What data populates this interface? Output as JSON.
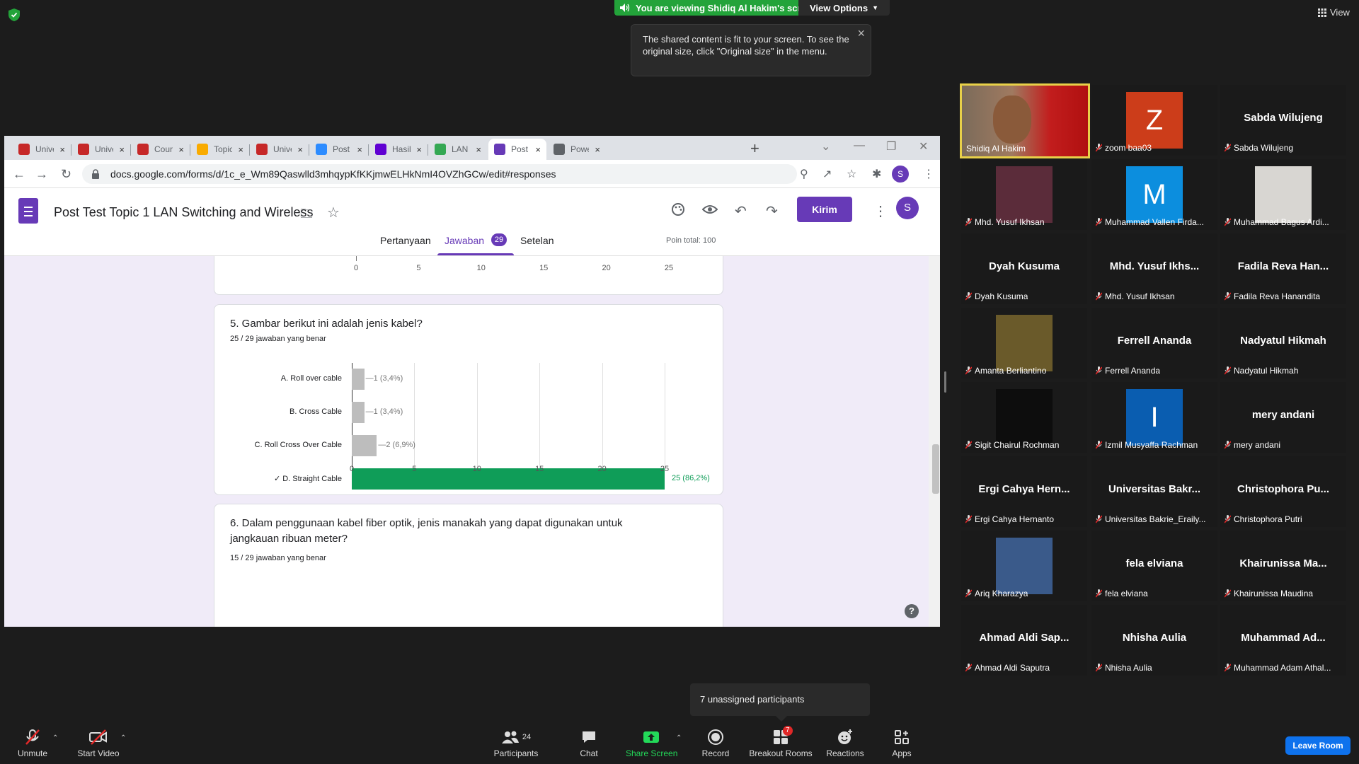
{
  "zoom": {
    "viewing_banner": "You are viewing Shidiq Al Hakim's screen",
    "view_options": "View Options",
    "tooltip": "The shared content is fit to your screen. To see the original size, click \"Original size\" in the menu.",
    "top_view": "View",
    "unassigned": "7 unassigned participants",
    "toolbar": {
      "unmute": "Unmute",
      "start_video": "Start Video",
      "participants": "Participants",
      "participants_count": "24",
      "chat": "Chat",
      "share_screen": "Share Screen",
      "record": "Record",
      "breakout_rooms": "Breakout Rooms",
      "breakout_badge": "7",
      "reactions": "Reactions",
      "apps": "Apps",
      "leave": "Leave Room"
    },
    "participants": [
      {
        "name": "Shidiq Al Hakim",
        "display": "",
        "video": true
      },
      {
        "name": "zoom baa03",
        "display": "Z",
        "avatar_color": "#cc3d1a"
      },
      {
        "name": "Sabda Wilujeng",
        "display": "Sabda Wilujeng"
      },
      {
        "name": "Mhd. Yusuf Ikhsan",
        "display": "",
        "photo": true
      },
      {
        "name": "Muhammad Vallen Firda...",
        "display": "M",
        "avatar_color": "#0c8ede"
      },
      {
        "name": "Muhammad Bagus Ardi...",
        "display": "",
        "photo": true
      },
      {
        "name": "Dyah Kusuma",
        "display": "Dyah Kusuma"
      },
      {
        "name": "Mhd. Yusuf Ikhsan",
        "display": "Mhd. Yusuf Ikhs..."
      },
      {
        "name": "Fadila Reva Hanandita",
        "display": "Fadila Reva Han..."
      },
      {
        "name": "Amanta Berliantino",
        "display": "",
        "photo": true
      },
      {
        "name": "Ferrell Ananda",
        "display": "Ferrell Ananda"
      },
      {
        "name": "Nadyatul Hikmah",
        "display": "Nadyatul Hikmah"
      },
      {
        "name": "Sigit Chairul Rochman",
        "display": "",
        "photo": true
      },
      {
        "name": "Izmil Musyaffa Rachman",
        "display": "I",
        "avatar_color": "#0a5db0"
      },
      {
        "name": "mery andani",
        "display": "mery andani"
      },
      {
        "name": "Ergi Cahya Hernanto",
        "display": "Ergi Cahya Hern..."
      },
      {
        "name": "Universitas Bakrie_Eraily...",
        "display": "Universitas Bakr..."
      },
      {
        "name": "Christophora Putri",
        "display": "Christophora Pu..."
      },
      {
        "name": "Ariq Kharazya",
        "display": "",
        "photo": true
      },
      {
        "name": "fela elviana",
        "display": "fela elviana"
      },
      {
        "name": "Khairunissa Maudina",
        "display": "Khairunissa Ma..."
      },
      {
        "name": "Ahmad Aldi Saputra",
        "display": "Ahmad Aldi Sap..."
      },
      {
        "name": "Nhisha Aulia",
        "display": "Nhisha Aulia"
      },
      {
        "name": "Muhammad Adam Athal...",
        "display": "Muhammad Ad..."
      }
    ]
  },
  "browser": {
    "tabs": [
      {
        "title": "Univer",
        "fav": "#c62828"
      },
      {
        "title": "Univer",
        "fav": "#c62828"
      },
      {
        "title": "Course",
        "fav": "#c62828"
      },
      {
        "title": "Topic 2",
        "fav": "#f9ab00"
      },
      {
        "title": "Univer",
        "fav": "#c62828"
      },
      {
        "title": "Post At",
        "fav": "#2d8cff"
      },
      {
        "title": "Hasil C",
        "fav": "#6001d2"
      },
      {
        "title": "LAN S",
        "fav": "#34a853"
      },
      {
        "title": "Post Te",
        "fav": "#673ab7"
      },
      {
        "title": "PowerI",
        "fav": "#5f6368"
      }
    ],
    "url": "docs.google.com/forms/d/1c_e_Wm89Qaswlld3mhqypKfKKjmwELHkNmI4OVZhGCw/edit#responses"
  },
  "form": {
    "title": "Post Test Topic 1 LAN Switching and Wireless",
    "kirim": "Kirim",
    "account_initial": "S",
    "tabs": {
      "pertanyaan": "Pertanyaan",
      "jawaban": "Jawaban",
      "jawaban_count": "29",
      "setelan": "Setelan"
    },
    "poin_total": "Poin total: 100",
    "q5": {
      "title": "5. Gambar berikut ini adalah jenis kabel?",
      "score": "25 / 29 jawaban yang benar"
    },
    "q6": {
      "title": "6. Dalam penggunaan kabel fiber optik, jenis manakah yang dapat digunakan untuk jangkauan ribuan meter?",
      "score": "15 / 29 jawaban yang benar"
    },
    "help": "?"
  },
  "chart_data": [
    {
      "type": "bar",
      "orientation": "horizontal",
      "title": "",
      "x_ticks": [
        0,
        5,
        10,
        15,
        20,
        25
      ],
      "xlim": [
        0,
        25
      ],
      "note": "partially visible axis of previous question"
    },
    {
      "type": "bar",
      "orientation": "horizontal",
      "title": "5. Gambar berikut ini adalah jenis kabel?",
      "categories": [
        "A. Roll over cable",
        "B. Cross Cable",
        "C. Roll Cross Over Cable",
        "✓ D. Straight Cable"
      ],
      "values": [
        1,
        1,
        2,
        25
      ],
      "labels": [
        "1 (3,4%)",
        "1 (3,4%)",
        "2 (6,9%)",
        "25 (86,2%)"
      ],
      "correct": [
        false,
        false,
        false,
        true
      ],
      "colors": {
        "default": "#bdbdbd",
        "correct": "#0f9d58"
      },
      "x_ticks": [
        0,
        5,
        10,
        15,
        20,
        25
      ],
      "xlim": [
        0,
        25
      ]
    }
  ]
}
